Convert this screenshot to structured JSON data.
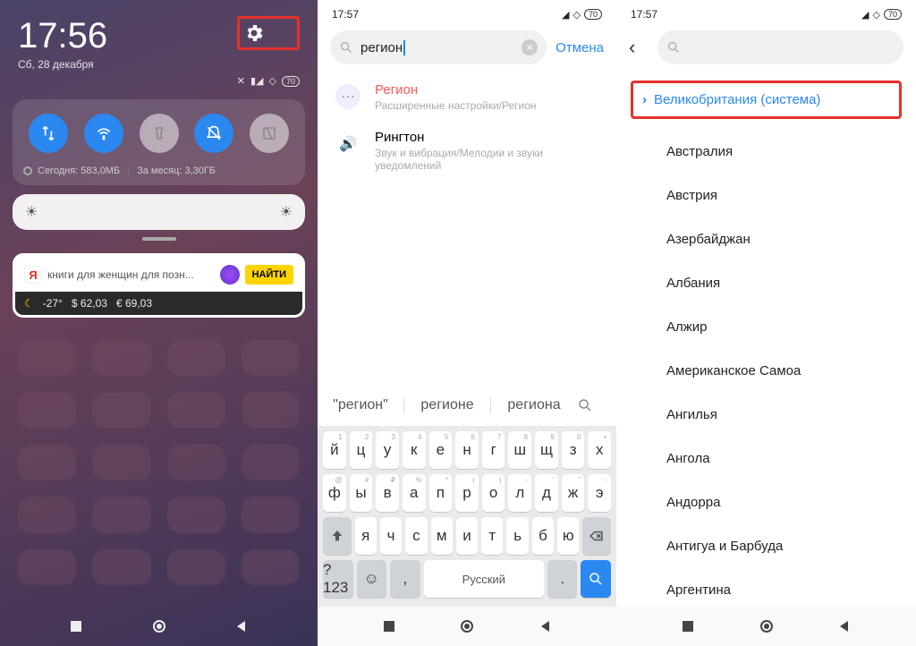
{
  "phone1": {
    "time": "17:56",
    "date": "Сб, 28 декабря",
    "battery": "70",
    "data_today_label": "Сегодня:",
    "data_today": "583,0МБ",
    "data_month_label": "За месяц:",
    "data_month": "3,30ГБ",
    "widget_search": "книги для женщин для позн...",
    "widget_find": "НАЙТИ",
    "weather_temp": "-27°",
    "usd": "$ 62,03",
    "eur": "€ 69,03"
  },
  "phone2": {
    "time": "17:57",
    "battery": "70",
    "search_value": "регион",
    "cancel": "Отмена",
    "results": [
      {
        "title": "Регион",
        "sub": "Расширенные настройки/Регион",
        "hl": true
      },
      {
        "title": "Рингтон",
        "sub": "Звук и вибрация/Мелодии и звуки уведомлений",
        "hl": false
      }
    ],
    "suggestions": [
      "\"регион\"",
      "регионе",
      "региона"
    ],
    "kb_rows": {
      "r1": [
        "й",
        "ц",
        "у",
        "к",
        "е",
        "н",
        "г",
        "ш",
        "щ",
        "з",
        "х"
      ],
      "r1_sup": [
        "1",
        "2",
        "3",
        "4",
        "5",
        "6",
        "7",
        "8",
        "9",
        "0",
        "+"
      ],
      "r2": [
        "ф",
        "ы",
        "в",
        "а",
        "п",
        "р",
        "о",
        "л",
        "д",
        "ж",
        "э"
      ],
      "r2_sup": [
        "@",
        "#",
        "₽",
        "%",
        "*",
        "(",
        ")",
        "-",
        "'",
        "\"",
        ":"
      ],
      "r3": [
        "я",
        "ч",
        "с",
        "м",
        "и",
        "т",
        "ь",
        "б",
        "ю"
      ],
      "space_label": "Русский",
      "num_label": "?123"
    }
  },
  "phone3": {
    "time": "17:57",
    "battery": "70",
    "selected": "Великобритания (система)",
    "countries": [
      "Австралия",
      "Австрия",
      "Азербайджан",
      "Албания",
      "Алжир",
      "Американское Самоа",
      "Ангилья",
      "Ангола",
      "Андорра",
      "Антигуа и Барбуда",
      "Аргентина"
    ]
  }
}
